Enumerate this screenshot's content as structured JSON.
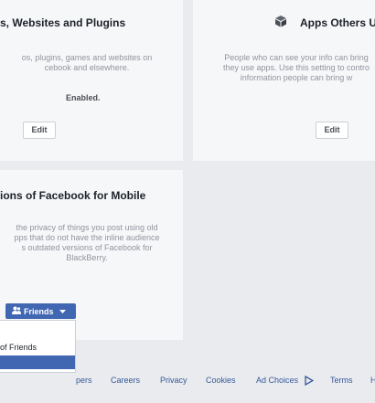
{
  "cards": {
    "apps_websites": {
      "title": "s, Websites and Plugins",
      "desc": "os, plugins, games and websites on\ncebook and elsewhere.",
      "status": "Enabled.",
      "edit": "Edit"
    },
    "apps_others_use": {
      "title": "Apps Others U",
      "desc": "People who can see your info can bring\nthey use apps. Use this setting to contro\ninformation people can bring w",
      "edit": "Edit"
    },
    "old_versions": {
      "title": "ions of Facebook for Mobile",
      "desc": "the privacy of things you post using old\npps that do not have the inline audience\ns outdated versions of Facebook for\nBlackBerry.",
      "audience_button": "Friends",
      "dropdown_items": [
        "of Friends"
      ]
    }
  },
  "footer": {
    "links": [
      "pers",
      "Careers",
      "Privacy",
      "Cookies",
      "Ad Choices",
      "Terms",
      "H"
    ]
  },
  "colors": {
    "background": "#e9ebee",
    "card": "#f6f7f9",
    "accent": "#4267b2",
    "link": "#365899"
  }
}
